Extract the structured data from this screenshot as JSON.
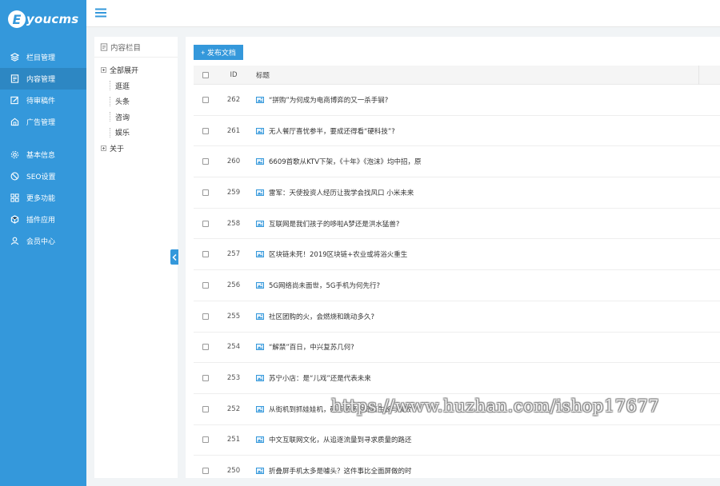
{
  "logo": {
    "letter": "E",
    "text": "youcms"
  },
  "sidebar": {
    "items": [
      {
        "label": "栏目管理",
        "icon": "layers-icon"
      },
      {
        "label": "内容管理",
        "icon": "document-icon",
        "active": true
      },
      {
        "label": "待审稿件",
        "icon": "edit-icon"
      },
      {
        "label": "广告管理",
        "icon": "ad-icon"
      },
      {
        "label": "基本信息",
        "icon": "gear-icon"
      },
      {
        "label": "SEO设置",
        "icon": "seo-icon"
      },
      {
        "label": "更多功能",
        "icon": "grid-icon"
      },
      {
        "label": "插件应用",
        "icon": "plugin-icon"
      },
      {
        "label": "会员中心",
        "icon": "user-icon"
      }
    ]
  },
  "tree": {
    "header": "内容栏目",
    "nodes": [
      {
        "label": "全部展开",
        "level": 0,
        "expandable": true
      },
      {
        "label": "逛逛",
        "level": 1
      },
      {
        "label": "头条",
        "level": 1
      },
      {
        "label": "咨询",
        "level": 1
      },
      {
        "label": "娱乐",
        "level": 1
      },
      {
        "label": "关于",
        "level": 0,
        "expandable": true
      }
    ]
  },
  "toolbar": {
    "publish_label": "+ 发布文档"
  },
  "table": {
    "columns": {
      "id": "ID",
      "title": "标题"
    },
    "rows": [
      {
        "id": "262",
        "title": "“拼购”为何成为电商博弈的又一杀手锏?"
      },
      {
        "id": "261",
        "title": "无人餐厅喜忧参半，要成还得看“硬科技”?"
      },
      {
        "id": "260",
        "title": "6609首歌从KTV下架，《十年》《泡沫》均中招，原"
      },
      {
        "id": "259",
        "title": "雷军：天使投资人经历让我学会找风口 小米未来"
      },
      {
        "id": "258",
        "title": "互联网是我们孩子的哆啦A梦还是洪水猛兽?"
      },
      {
        "id": "257",
        "title": "区块链未死！2019区块链+农业或将浴火重生"
      },
      {
        "id": "256",
        "title": "5G网络尚未面世，5G手机为何先行?"
      },
      {
        "id": "255",
        "title": "社区团购的火，会燃烧和跳动多久?"
      },
      {
        "id": "254",
        "title": "“解禁”百日，中兴复苏几何?"
      },
      {
        "id": "253",
        "title": "苏宁小店：是“儿戏”还是代表未来"
      },
      {
        "id": "252",
        "title": "从街机到抓娃娃机，硬币经济的野蛮生长与衰败"
      },
      {
        "id": "251",
        "title": "中文互联网文化，从追逐流量到寻求质量的路还"
      },
      {
        "id": "250",
        "title": "折叠屏手机太多是噱头？这件事比全面屏做的时"
      }
    ]
  },
  "watermark": "https://www.huzhan.com/ishop17677",
  "colors": {
    "primary": "#3498db",
    "active": "#2d87c3",
    "bg": "#f1f4f6"
  }
}
